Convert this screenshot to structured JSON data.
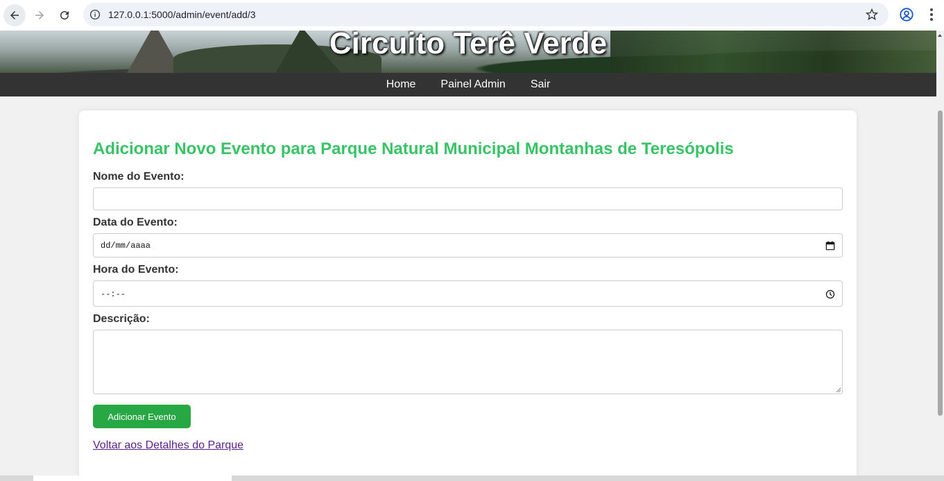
{
  "browser": {
    "url": "127.0.0.1:5000/admin/event/add/3"
  },
  "site": {
    "title": "Circuito Terê Verde"
  },
  "nav": {
    "items": [
      "Home",
      "Painel Admin",
      "Sair"
    ]
  },
  "form": {
    "heading": "Adicionar Novo Evento para Parque Natural Municipal Montanhas de Teresópolis",
    "name_label": "Nome do Evento:",
    "name_value": "",
    "date_label": "Data do Evento:",
    "date_placeholder": "dd/mm/aaaa",
    "time_label": "Hora do Evento:",
    "time_placeholder": "--:--",
    "description_label": "Descrição:",
    "description_value": "",
    "submit_label": "Adicionar Evento",
    "back_link": "Voltar aos Detalhes do Parque"
  },
  "colors": {
    "heading": "#38c466",
    "button": "#28a745",
    "navbar": "#333333",
    "link": "#5a1e8a"
  }
}
